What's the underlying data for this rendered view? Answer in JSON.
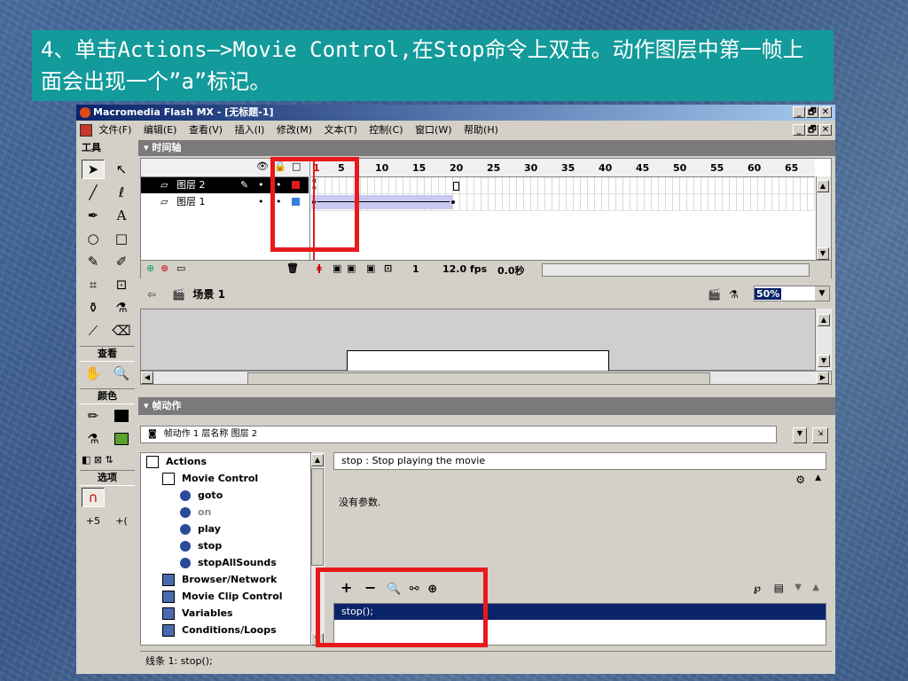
{
  "caption": "4、单击Actions—>Movie Control,在Stop命令上双击。动作图层中第一帧上面会出现一个”a”标记。",
  "window": {
    "title": "Macromedia Flash MX - [无标题-1]",
    "menu": [
      "文件(F)",
      "编辑(E)",
      "查看(V)",
      "插入(I)",
      "修改(M)",
      "文本(T)",
      "控制(C)",
      "窗口(W)",
      "帮助(H)"
    ],
    "buttons": [
      "_",
      "🗗",
      "✕"
    ]
  },
  "tools": {
    "header": "工具",
    "view_label": "查看",
    "color_label": "颜色",
    "options_label": "选项"
  },
  "timeline": {
    "header": "▾ 时间轴",
    "ruler": [
      "1",
      "5",
      "10",
      "15",
      "20",
      "25",
      "30",
      "35",
      "40",
      "45",
      "50",
      "55",
      "60",
      "65"
    ],
    "layers": [
      {
        "name": "图层 2",
        "selected": true
      },
      {
        "name": "图层 1",
        "selected": false
      }
    ],
    "frame": "1",
    "fps": "12.0 fps",
    "time": "0.0秒"
  },
  "scene": {
    "name": "场景 1",
    "zoom": "50%"
  },
  "actions": {
    "header": "▾ 帧动作",
    "selector": "帧动作 1 层名称 图层 2",
    "tree": [
      {
        "label": "Actions",
        "level": 0,
        "icon": "book-open"
      },
      {
        "label": "Movie Control",
        "level": 1,
        "icon": "book-open"
      },
      {
        "label": "goto",
        "level": 2,
        "icon": "action"
      },
      {
        "label": "on",
        "level": 2,
        "icon": "action",
        "disabled": true
      },
      {
        "label": "play",
        "level": 2,
        "icon": "action"
      },
      {
        "label": "stop",
        "level": 2,
        "icon": "action"
      },
      {
        "label": "stopAllSounds",
        "level": 2,
        "icon": "action"
      },
      {
        "label": "Browser/Network",
        "level": 1,
        "icon": "book-closed"
      },
      {
        "label": "Movie Clip Control",
        "level": 1,
        "icon": "book-closed"
      },
      {
        "label": "Variables",
        "level": 1,
        "icon": "book-closed"
      },
      {
        "label": "Conditions/Loops",
        "level": 1,
        "icon": "book-closed"
      }
    ],
    "description": "stop : Stop playing the movie",
    "no_params": "没有参数.",
    "script_line": "stop();",
    "status": "线条 1: stop();"
  },
  "colors": {
    "caption_bg": "#139a9a",
    "highlight": "#e8191c",
    "selection": "#0a246a"
  }
}
